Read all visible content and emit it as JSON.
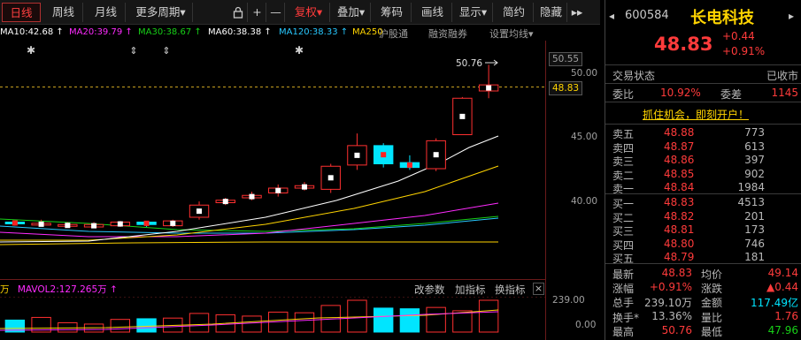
{
  "toolbar": {
    "daily": "日线",
    "weekly": "周线",
    "monthly": "月线",
    "more_periods": "更多周期",
    "restore": "复权",
    "overlay": "叠加",
    "chips": "筹码",
    "draw": "画线",
    "display": "显示",
    "simple": "简约",
    "hide": "隐藏",
    "dropdown_arrow": "▾",
    "expand_arrows": "▸▸",
    "plus": "+",
    "minus": "—",
    "lock_icon": "lock-icon"
  },
  "ma": {
    "ma10": "MA10:42.68 ↑",
    "ma20": "MA20:39.79 ↑",
    "ma30": "MA30:38.67 ↑",
    "ma60": "MA60:38.38 ↑",
    "ma120": "MA120:38.33 ↑",
    "ma250": "MA250",
    "links": [
      "沪股通",
      "融资融券",
      "设置均线"
    ],
    "colors": {
      "ma10": "#ffffff",
      "ma20": "#ffd400",
      "ma30": "#ff2bff",
      "ma60": "#17d017",
      "ma120": "#28c8ff",
      "ma250": "#ffd400"
    }
  },
  "chart": {
    "price_labels": [
      "50.55",
      "50.00",
      "45.00",
      "40.00"
    ],
    "last_price_box": "48.83",
    "high_annotation": "50.76"
  },
  "chart_data": {
    "type": "candlestick",
    "ylim": [
      35,
      51
    ],
    "candles": [
      {
        "open": 37.8,
        "close": 37.7,
        "high": 37.9,
        "low": 37.5
      },
      {
        "open": 37.6,
        "close": 37.7,
        "high": 38.0,
        "low": 37.5
      },
      {
        "open": 37.5,
        "close": 37.6,
        "high": 37.8,
        "low": 37.4
      },
      {
        "open": 37.4,
        "close": 37.6,
        "high": 37.8,
        "low": 37.3
      },
      {
        "open": 37.5,
        "close": 37.8,
        "high": 37.9,
        "low": 37.4
      },
      {
        "open": 37.8,
        "close": 37.6,
        "high": 37.9,
        "low": 37.4
      },
      {
        "open": 37.5,
        "close": 37.9,
        "high": 38.0,
        "low": 37.4
      },
      {
        "open": 38.2,
        "close": 39.2,
        "high": 39.5,
        "low": 38.0
      },
      {
        "open": 39.4,
        "close": 39.6,
        "high": 39.8,
        "low": 39.2
      },
      {
        "open": 39.8,
        "close": 40.0,
        "high": 40.3,
        "low": 39.6
      },
      {
        "open": 40.2,
        "close": 40.6,
        "high": 40.9,
        "low": 39.9
      },
      {
        "open": 40.6,
        "close": 40.8,
        "high": 41.1,
        "low": 40.4
      },
      {
        "open": 40.5,
        "close": 42.4,
        "high": 42.6,
        "low": 40.2
      },
      {
        "open": 42.5,
        "close": 44.1,
        "high": 45.1,
        "low": 42.1
      },
      {
        "open": 44.1,
        "close": 42.6,
        "high": 44.3,
        "low": 42.3
      },
      {
        "open": 42.7,
        "close": 42.3,
        "high": 43.3,
        "low": 42.1
      },
      {
        "open": 42.2,
        "close": 44.5,
        "high": 44.7,
        "low": 42.0
      },
      {
        "open": 45.0,
        "close": 48.0,
        "high": 48.1,
        "low": 45.0
      },
      {
        "open": 48.6,
        "close": 49.1,
        "high": 50.76,
        "low": 48.0
      }
    ]
  },
  "volume": {
    "legend_prefix": "万",
    "mavol": "MAVOL2:127.265万 ↑",
    "tools": [
      "改参数",
      "加指标",
      "换指标"
    ],
    "close": "×",
    "axis": [
      "239.00",
      "0.00"
    ],
    "values": [
      90,
      110,
      70,
      60,
      95,
      100,
      105,
      140,
      130,
      120,
      150,
      145,
      200,
      239,
      180,
      175,
      185,
      160,
      239
    ]
  },
  "quote": {
    "code": "600584",
    "name": "长电科技",
    "price": "48.83",
    "change": "+0.44",
    "change_pct": "+0.91%",
    "nav_left": "◂",
    "nav_right": "▸",
    "status_label": "交易状态",
    "status_value": "已收市",
    "ratio_label": "委比",
    "ratio_value": "10.92%",
    "diff_label": "委差",
    "diff_value": "1145",
    "promo": "抓住机会，即刻开户！",
    "sells": [
      {
        "label": "卖五",
        "price": "48.88",
        "vol": "773"
      },
      {
        "label": "卖四",
        "price": "48.87",
        "vol": "613"
      },
      {
        "label": "卖三",
        "price": "48.86",
        "vol": "397"
      },
      {
        "label": "卖二",
        "price": "48.85",
        "vol": "902"
      },
      {
        "label": "卖一",
        "price": "48.84",
        "vol": "1984"
      }
    ],
    "buys": [
      {
        "label": "买一",
        "price": "48.83",
        "vol": "4513"
      },
      {
        "label": "买二",
        "price": "48.82",
        "vol": "201"
      },
      {
        "label": "买三",
        "price": "48.81",
        "vol": "173"
      },
      {
        "label": "买四",
        "price": "48.80",
        "vol": "746"
      },
      {
        "label": "买五",
        "price": "48.79",
        "vol": "181"
      }
    ],
    "stats": [
      {
        "l1": "最新",
        "v1": "48.83",
        "l2": "均价",
        "v2": "49.14"
      },
      {
        "l1": "涨幅",
        "v1": "+0.91%",
        "l2": "涨跌",
        "v2": "▲0.44"
      },
      {
        "l1": "总手",
        "v1": "239.10万",
        "l2": "金额",
        "v2": "117.49亿"
      },
      {
        "l1": "换手*",
        "v1": "13.36%",
        "l2": "量比",
        "v2": "1.76"
      },
      {
        "l1": "最高",
        "v1": "50.76",
        "l2": "最低",
        "v2": "47.96"
      }
    ]
  }
}
